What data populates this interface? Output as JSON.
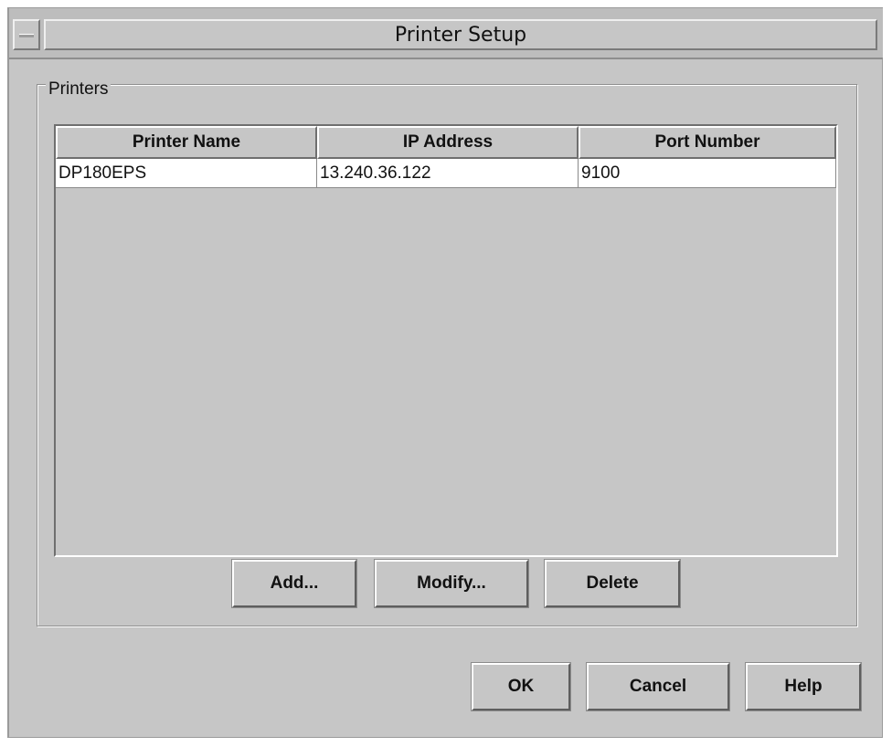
{
  "window": {
    "title": "Printer Setup"
  },
  "printers_group": {
    "label": "Printers",
    "columns": [
      "Printer Name",
      "IP Address",
      "Port Number"
    ],
    "rows": [
      [
        "DP180EPS",
        "13.240.36.122",
        "9100"
      ]
    ],
    "buttons": {
      "add": "Add...",
      "modify": "Modify...",
      "delete": "Delete"
    }
  },
  "dialog_buttons": {
    "ok": "OK",
    "cancel": "Cancel",
    "help": "Help"
  },
  "icons": {
    "window_menu": "window-menu-icon"
  }
}
